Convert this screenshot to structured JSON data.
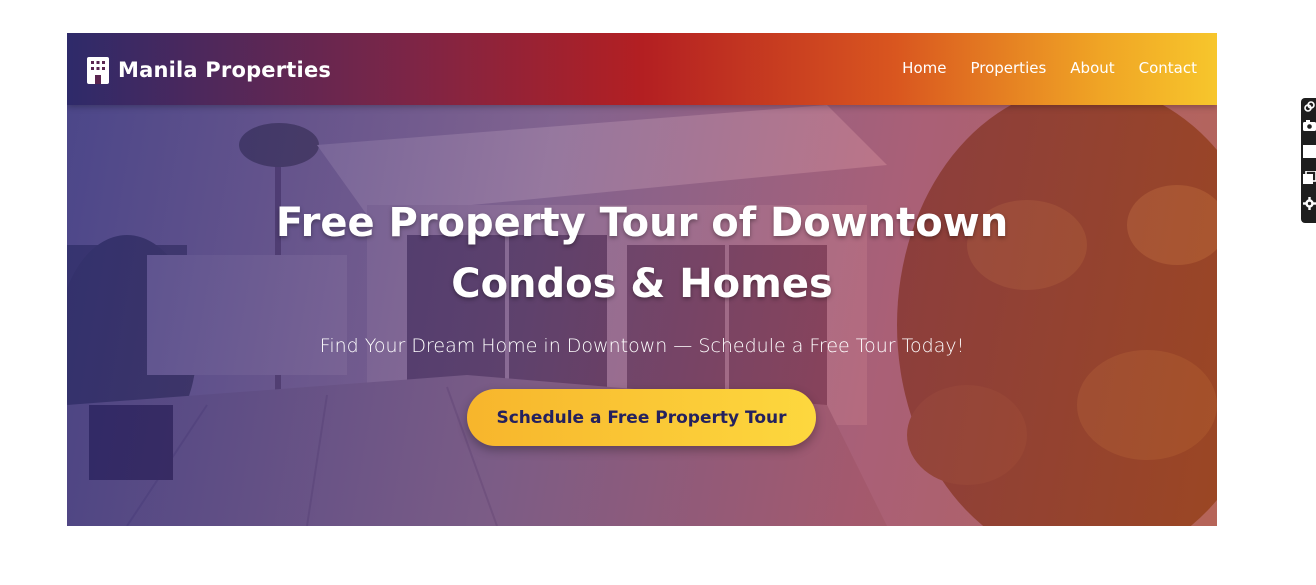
{
  "header": {
    "brand_name": "Manila Properties",
    "brand_icon": "building-icon",
    "nav": [
      {
        "label": "Home"
      },
      {
        "label": "Properties"
      },
      {
        "label": "About"
      },
      {
        "label": "Contact"
      }
    ]
  },
  "hero": {
    "title": "Free Property Tour of Downtown Condos & Homes",
    "subtitle": "Find Your Dream Home in Downtown — Schedule a Free Tour Today!",
    "cta_label": "Schedule a Free Property Tour",
    "background": "modern-house-photo"
  },
  "side_toolbar": {
    "tools": [
      "link-icon",
      "camera-icon",
      "square-icon",
      "copy-icon",
      "gear-icon"
    ]
  },
  "colors": {
    "nav_gradient_start": "#2e2a6a",
    "nav_gradient_mid": "#b31f22",
    "nav_gradient_end": "#f7c62c",
    "cta_background": "#fdd83e",
    "cta_text": "#24215e",
    "text_light": "#ffffff"
  }
}
